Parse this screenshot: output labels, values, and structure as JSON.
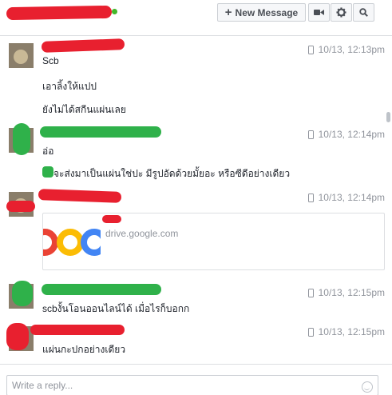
{
  "header": {
    "new_message_label": "New Message",
    "icons": [
      "plus-icon",
      "video-camera-icon",
      "gear-icon",
      "search-icon"
    ],
    "online_color": "#42b72a"
  },
  "messages": [
    {
      "timestamp": "10/13, 12:13pm",
      "lines": [
        "Scb",
        "เอาลิ้งให้แปป",
        "ยังไม่ได้สกีนแผ่นเลย"
      ]
    },
    {
      "timestamp": "10/13, 12:14pm",
      "lines": [
        "อ่อ",
        "จะส่งมาเป็นแผ่นใช่ปะ มีรูปอัดด้วยมั้ยอะ หรือซีดีอย่างเดียว"
      ]
    },
    {
      "timestamp": "10/13, 12:14pm",
      "link": {
        "domain": "drive.google.com"
      }
    },
    {
      "timestamp": "10/13, 12:15pm",
      "lines": [
        "scbงั้นโอนออนไลน์ได้ เมื่อไรก็บอกก"
      ]
    },
    {
      "timestamp": "10/13, 12:15pm",
      "lines": [
        "แผ่นกะปกอย่างเดียว"
      ]
    }
  ],
  "reply": {
    "placeholder": "Write a reply..."
  },
  "colors": {
    "redaction_red": "#e8202f",
    "redaction_green": "#2fb14a",
    "timestamp_gray": "#90949c"
  }
}
